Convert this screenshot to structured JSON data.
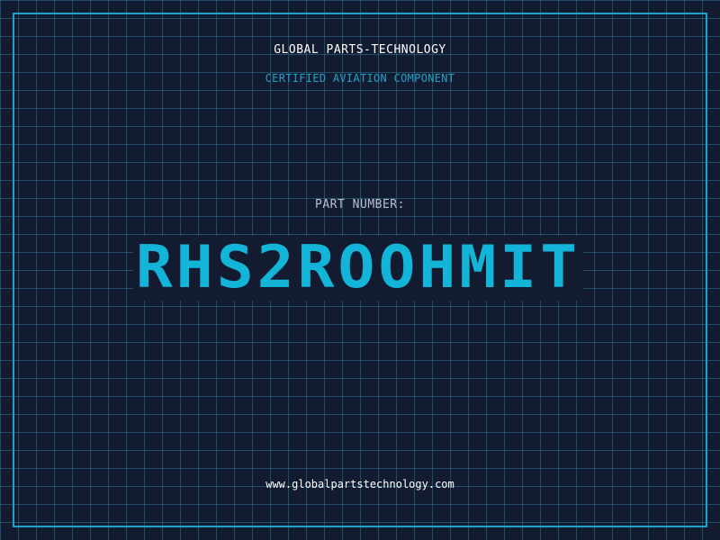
{
  "header": {
    "brand": "GLOBAL PARTS-TECHNOLOGY",
    "subtitle": "CERTIFIED AVIATION COMPONENT"
  },
  "part": {
    "label": "PART NUMBER:",
    "number": "RHS2ROOHMIT"
  },
  "footer": {
    "url": "www.globalpartstechnology.com"
  },
  "colors": {
    "background": "#121b30",
    "grid": "#28788f",
    "accent": "#1fa3c9",
    "part_number": "#12b4d8",
    "text": "#ffffff"
  }
}
